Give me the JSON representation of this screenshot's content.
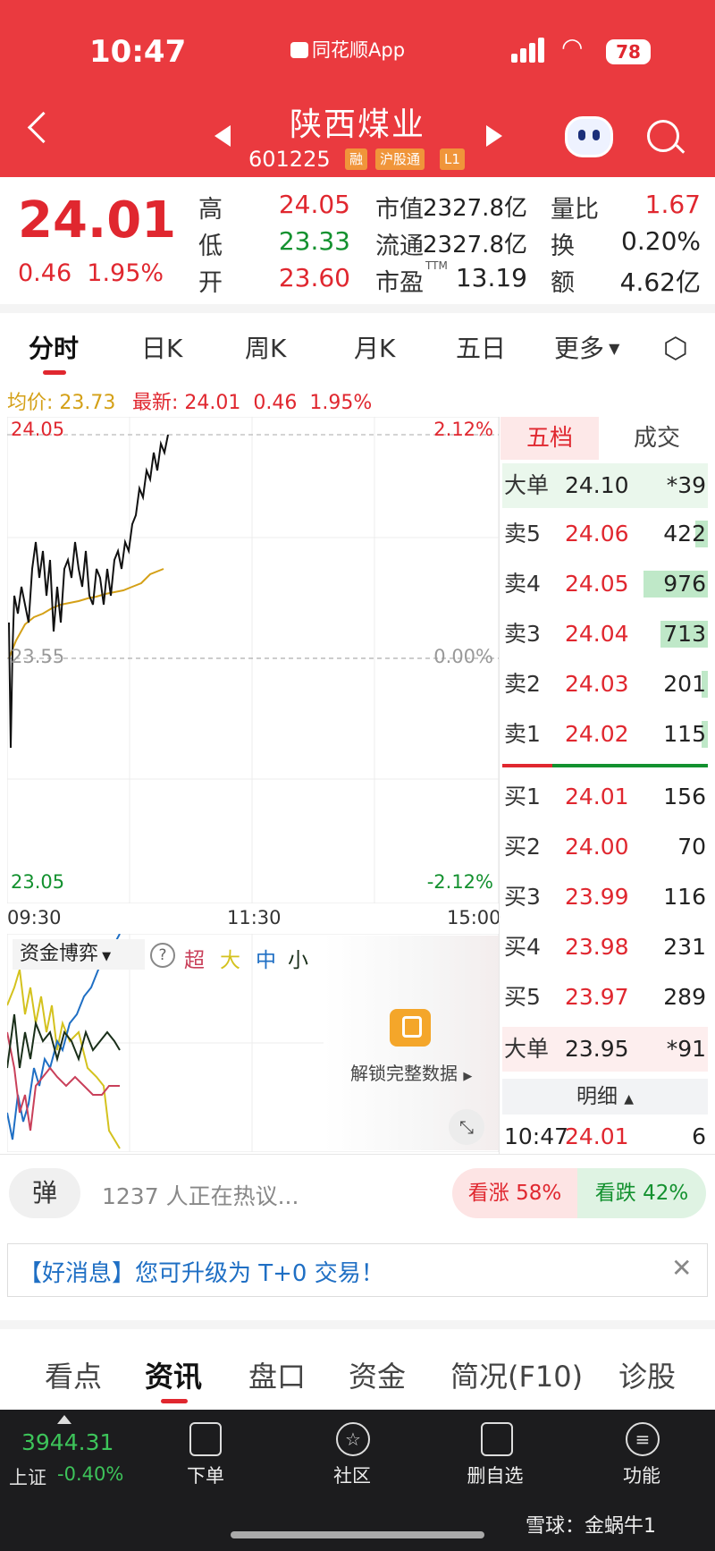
{
  "status": {
    "time": "10:47",
    "app": "同花顺App",
    "battery": "78"
  },
  "stock": {
    "name": "陕西煤业",
    "code": "601225",
    "tags": [
      "融",
      "沪股通",
      "L1"
    ]
  },
  "quote": {
    "price": "24.01",
    "change": "0.46",
    "pct": "1.95%",
    "cells": [
      {
        "l": "高",
        "v": "24.05"
      },
      {
        "l": "低",
        "v": "23.33"
      },
      {
        "l": "开",
        "v": "23.60"
      },
      {
        "l": "市值",
        "v": "2327.8亿"
      },
      {
        "l": "流通",
        "v": "2327.8亿"
      },
      {
        "l": "市盈",
        "sup": "TTM",
        "v": "13.19"
      },
      {
        "l": "量比",
        "v": "1.67"
      },
      {
        "l": "换",
        "v": "0.20%"
      },
      {
        "l": "额",
        "v": "4.62亿"
      }
    ]
  },
  "tabs": [
    "分时",
    "日K",
    "周K",
    "月K",
    "五日",
    "更多"
  ],
  "subline": {
    "avg_label": "均价: 23.73",
    "latest_label": "最新: 24.01",
    "latest_chg": "0.46",
    "latest_pct": "1.95%"
  },
  "chart": {
    "y_top": "24.05",
    "y_mid": "23.55",
    "y_bot": "23.05",
    "pct_top": "2.12%",
    "pct_mid": "0.00%",
    "pct_bot": "-2.12%",
    "times": [
      "09:30",
      "11:30",
      "15:00"
    ]
  },
  "orderbook": {
    "tabs": [
      "五档",
      "成交"
    ],
    "top": {
      "label": "大单",
      "price": "24.10",
      "vol": "*39"
    },
    "sells": [
      {
        "label": "卖5",
        "price": "24.06",
        "vol": "422",
        "bar": 0.2
      },
      {
        "label": "卖4",
        "price": "24.05",
        "vol": "976",
        "bar": 1.0
      },
      {
        "label": "卖3",
        "price": "24.04",
        "vol": "713",
        "bar": 0.73
      },
      {
        "label": "卖2",
        "price": "24.03",
        "vol": "201",
        "bar": 0.1
      },
      {
        "label": "卖1",
        "price": "24.02",
        "vol": "115",
        "bar": 0.1
      }
    ],
    "buys": [
      {
        "label": "买1",
        "price": "24.01",
        "vol": "156"
      },
      {
        "label": "买2",
        "price": "24.00",
        "vol": "70"
      },
      {
        "label": "买3",
        "price": "23.99",
        "vol": "116"
      },
      {
        "label": "买4",
        "price": "23.98",
        "vol": "231"
      },
      {
        "label": "买5",
        "price": "23.97",
        "vol": "289"
      }
    ],
    "bottom": {
      "label": "大单",
      "price": "23.95",
      "vol": "*91"
    },
    "detail_label": "明细",
    "trade": {
      "time": "10:47",
      "price": "24.01",
      "vol": "6"
    }
  },
  "flow": {
    "title": "资金博弈",
    "legend": [
      "超",
      "大",
      "中",
      "小"
    ],
    "unlock": "解锁完整数据"
  },
  "discuss": {
    "btn": "弹",
    "text": "1237 人正在热议...",
    "up": "看涨 58%",
    "down": "看跌 42%"
  },
  "notice": {
    "text": "【好消息】您可升级为 T+0 交易！"
  },
  "bottom_tabs": [
    "看点",
    "资讯",
    "盘口",
    "资金",
    "简况(F10)",
    "诊股"
  ],
  "bottom_bar": {
    "index_value": "3944.31",
    "index_name": "上证",
    "index_chg": "-0.40%",
    "items": [
      "下单",
      "社区",
      "删自选",
      "功能"
    ],
    "watermark": "雪球：金蜗牛1"
  }
}
